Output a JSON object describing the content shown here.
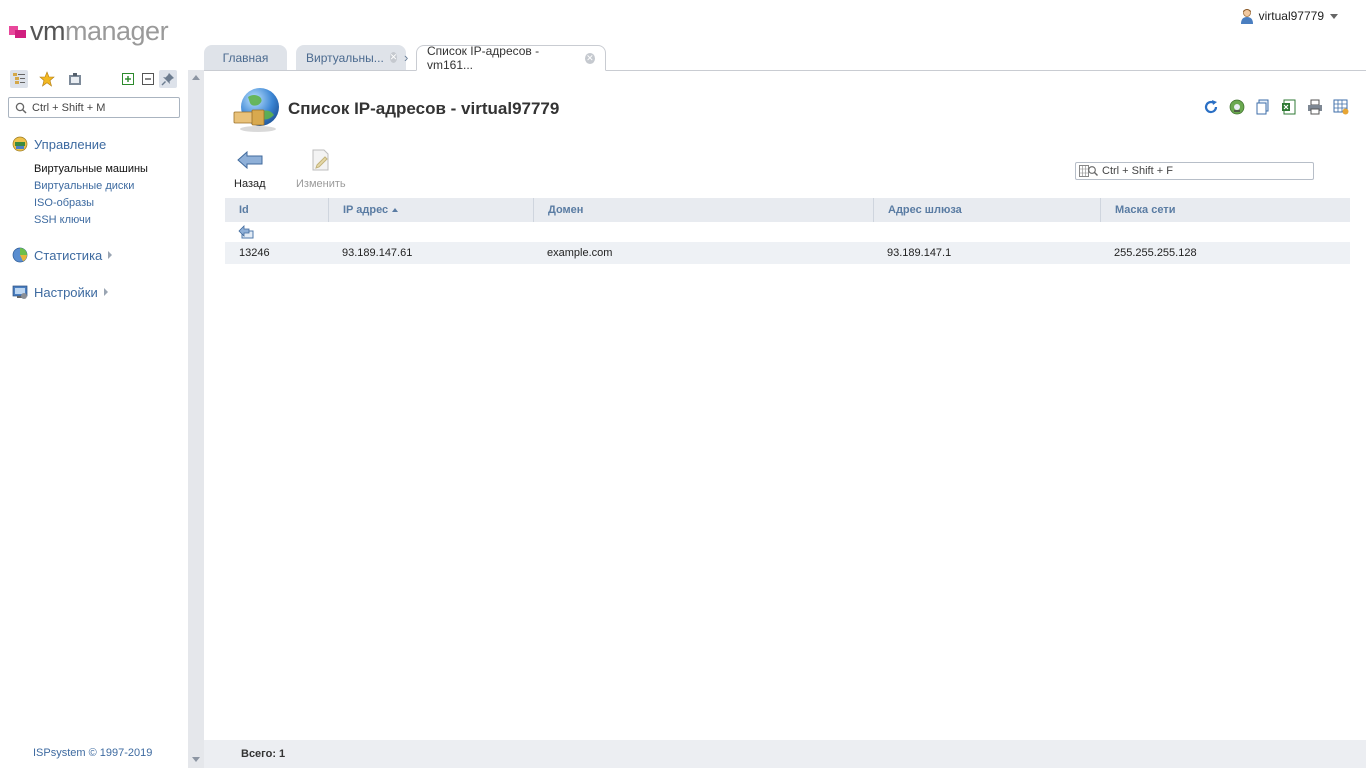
{
  "app": {
    "brand_vm": "vm",
    "brand_manager": "manager"
  },
  "user": {
    "name": "virtual97779"
  },
  "tabs": [
    {
      "label": "Главная"
    },
    {
      "label": "Виртуальны..."
    },
    {
      "label": "Список IP-адресов - vm161..."
    }
  ],
  "sidebar": {
    "search_placeholder": "Ctrl + Shift + M",
    "groups": [
      {
        "label": "Управление"
      },
      {
        "label": "Статистика"
      },
      {
        "label": "Настройки"
      }
    ],
    "items": [
      {
        "label": "Виртуальные машины"
      },
      {
        "label": "Виртуальные диски"
      },
      {
        "label": "ISO-образы"
      },
      {
        "label": "SSH ключи"
      }
    ],
    "copyright": "ISPsystem © 1997-2019"
  },
  "page": {
    "title": "Список IP-адресов - virtual97779",
    "actions": {
      "back": "Назад",
      "edit": "Изменить"
    },
    "filter_placeholder": "Ctrl + Shift + F"
  },
  "table": {
    "columns": [
      "Id",
      "IP адрес",
      "Домен",
      "Адрес шлюза",
      "Маска сети"
    ],
    "rows": [
      [
        "13246",
        "93.189.147.61",
        "example.com",
        "93.189.147.1",
        "255.255.255.128"
      ]
    ]
  },
  "footer": {
    "total": "Всего: 1"
  },
  "colors": {
    "link": "#3d6aa0",
    "header_text": "#5a7ca3",
    "row_bg": "#eef1f5",
    "brand_pink": "#e8479b"
  }
}
